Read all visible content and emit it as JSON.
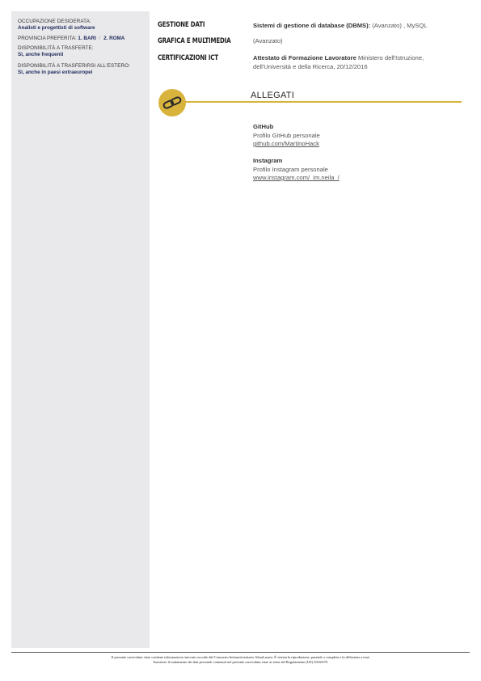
{
  "sidebar": {
    "occupation_label": "OCCUPAZIONE DESIDERATA:",
    "occupation_value": "Analisti e progettisti di software",
    "province_label": "PROVINCIA PREFERITA:",
    "province_1": "1. BARI",
    "province_sep": "/",
    "province_2": "2. ROMA",
    "travel_label": "DISPONIBILITÀ A TRASFERTE:",
    "travel_value": "Sì, anche frequenti",
    "abroad_label": "DISPONIBILITÀ A TRASFERIRSI ALL'ESTERO:",
    "abroad_value": "Sì, anche in paesi extraeuropei"
  },
  "skills": {
    "data_label": "GESTIONE DATI",
    "data_bold": "Sistemi di gestione di database (DBMS):",
    "data_rest": " (Avanzato) , MySQL",
    "graphics_label": "GRAFICA E MULTIMEDIA",
    "graphics_text": "(Avanzato)",
    "cert_label": "CERTIFICAZIONI ICT",
    "cert_bold": "Attestato di Formazione Lavoratore",
    "cert_rest": " Ministero dell'Istruzione, dell'Università e della Ricerca, 20/12/2016"
  },
  "attachments": {
    "title": "ALLEGATI",
    "icon": "link-chain-icon",
    "accent_color": "#d8b43c",
    "items": [
      {
        "name": "GitHub",
        "description": "Profilo GitHub personale",
        "url": "github.com/MartinoHack"
      },
      {
        "name": "Instagram",
        "description": "Profilo Instagram personale",
        "url": "www.instagram.com/_im.neila_/"
      }
    ]
  },
  "footer": {
    "line1": "Il presente curriculum vitae contiene informazioni riservate raccolte dal Consorzio Interuniversitario AlmaLaurea. È vietata la riproduzione, parziale o completa e la diffusione a terzi",
    "line2": "Autorizzo il trattamento dei dati personali contenuti nel presente curriculum vitae ai sensi del Regolamento (UE) 2016/679."
  }
}
